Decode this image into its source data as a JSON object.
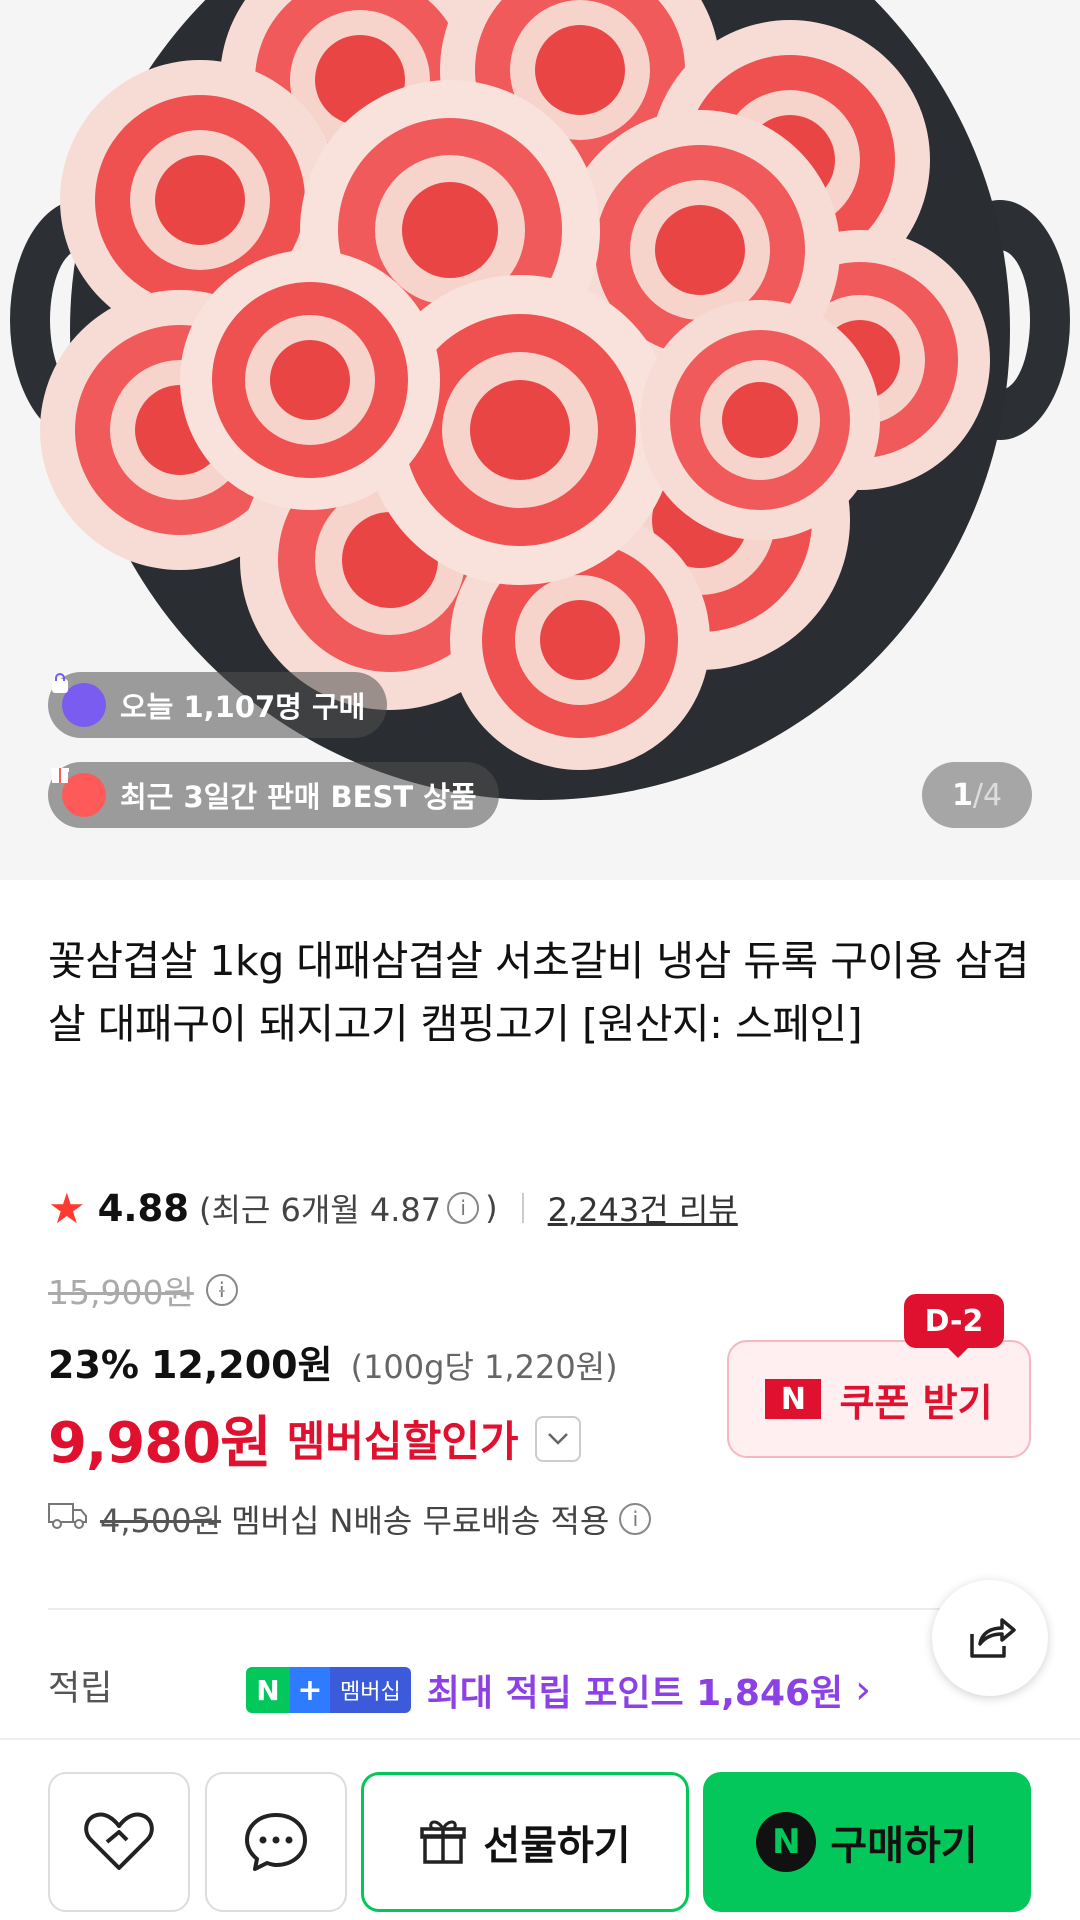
{
  "hero": {
    "badge_today": "오늘 1,107명 구매",
    "badge_best": "최근 3일간 판매 BEST 상품",
    "counter_current": "1",
    "counter_sep": " / ",
    "counter_total": "4"
  },
  "product": {
    "title": "꽃삼겹살 1kg 대패삼겹살 서초갈비 냉삼 듀록 구이용 삼겹살 대패구이 돼지고기 캠핑고기 [원산지: 스페인]"
  },
  "rating": {
    "score": "4.88",
    "recent_prefix": "(최근 6개월 4.87",
    "recent_suffix": ")",
    "reviews": "2,243건 리뷰"
  },
  "price": {
    "original": "15,900원",
    "discount_pct": "23%",
    "sale": "12,200원",
    "unit": "(100g당 1,220원)",
    "member_price": "9,980원",
    "member_label": "멤버십할인가"
  },
  "coupon": {
    "dday": "D-2",
    "logo": "N",
    "label": "쿠폰 받기"
  },
  "shipping": {
    "fee": "4,500원",
    "text": "멤버십 N배송 무료배송 적용"
  },
  "points": {
    "label": "적립",
    "badge_n": "N",
    "badge_plus": "+",
    "badge_member": "멤버십",
    "text": "최대 적립 포인트 1,846원",
    "arrow": "›"
  },
  "bottom": {
    "gift_label": "선물하기",
    "buy_logo": "N",
    "buy_label": "구매하기"
  },
  "colors": {
    "accent_red": "#e0112f",
    "naver_green": "#03c75a",
    "points_purple": "#8b41e6"
  }
}
